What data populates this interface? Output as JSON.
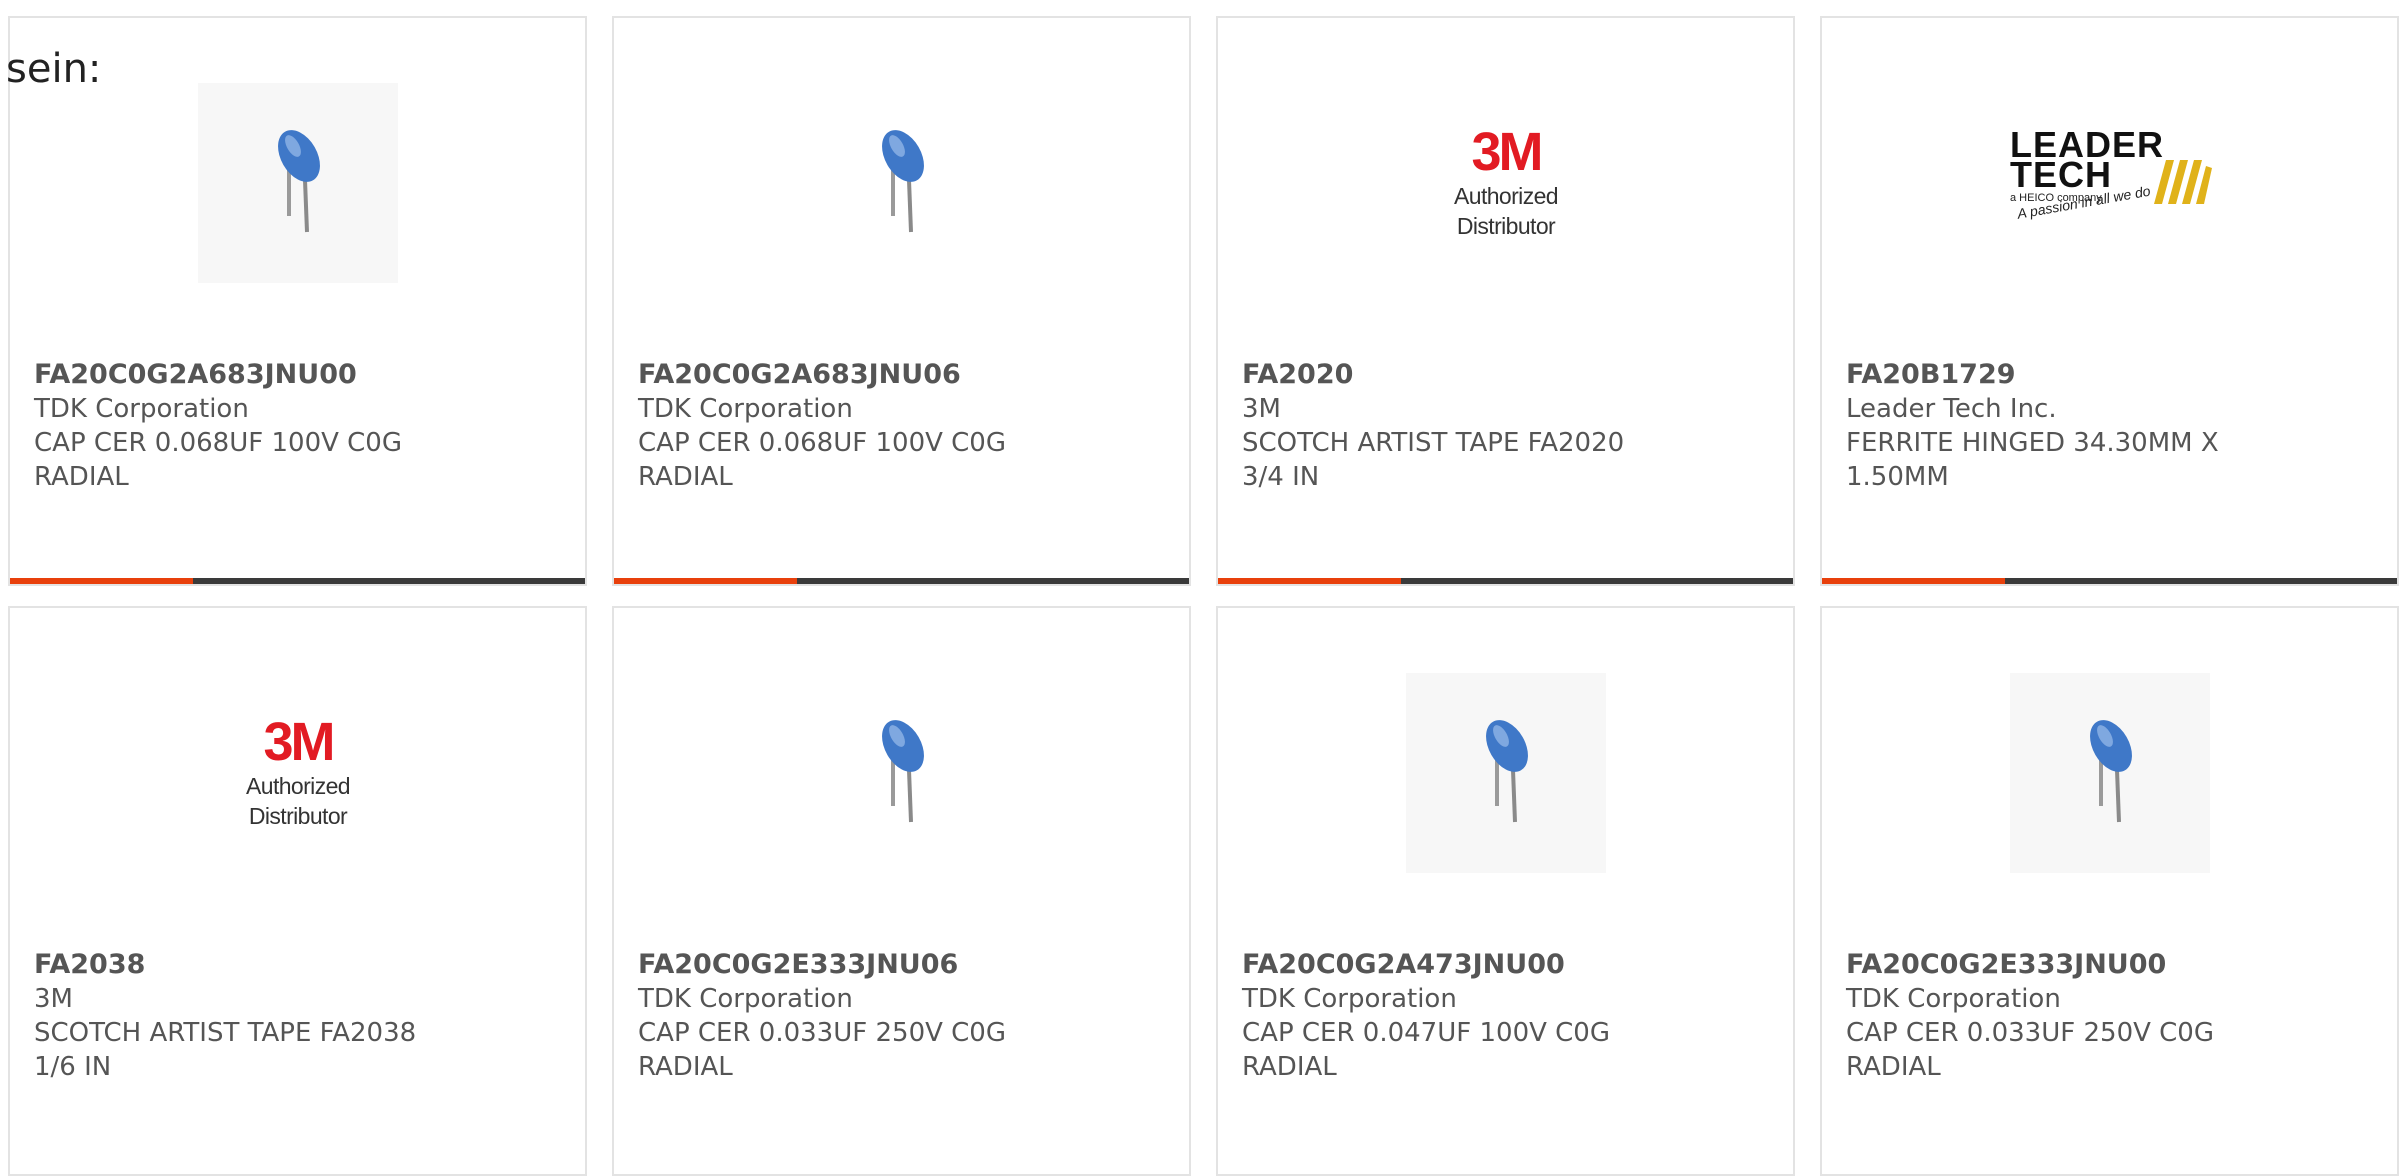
{
  "intro_text": "sein:",
  "colors": {
    "accent": "#e8400c",
    "bar": "#3a3a3a",
    "text": "#555555",
    "capacitor_blue": "#3f78c8"
  },
  "products": [
    {
      "part_number": "FA20C0G2A683JNU00",
      "manufacturer": "TDK Corporation",
      "description": "CAP CER 0.068UF 100V C0G RADIAL",
      "image": "capacitor-icon",
      "desc_lines": [
        "CAP CER 0.068UF 100V C0G",
        "RADIAL"
      ]
    },
    {
      "part_number": "FA20C0G2A683JNU06",
      "manufacturer": "TDK Corporation",
      "description": "CAP CER 0.068UF 100V C0G RADIAL",
      "image": "capacitor-icon",
      "desc_lines": [
        "CAP CER 0.068UF 100V C0G",
        "RADIAL"
      ]
    },
    {
      "part_number": "FA2020",
      "manufacturer": "3M",
      "description": "SCOTCH ARTIST TAPE FA2020 3/4 IN",
      "image": "3m-authorized-distributor-logo",
      "logo_mark": "3M",
      "logo_tagline": "Authorized Distributor",
      "desc_lines": [
        "SCOTCH ARTIST TAPE FA2020",
        "3/4 IN"
      ]
    },
    {
      "part_number": "FA20B1729",
      "manufacturer": "Leader Tech Inc.",
      "description": "FERRITE HINGED 34.30MM X 1.50MM",
      "image": "leader-tech-logo",
      "logo_line1": "LEADER",
      "logo_line2": "TECH",
      "logo_sub": "a HEICO company",
      "logo_slogan": "A passion in all we do",
      "desc_lines": [
        "FERRITE HINGED 34.30MM X",
        "1.50MM"
      ]
    },
    {
      "part_number": "FA2038",
      "manufacturer": "3M",
      "description": "SCOTCH ARTIST TAPE FA2038 1/6 IN",
      "image": "3m-authorized-distributor-logo",
      "logo_mark": "3M",
      "logo_tagline": "Authorized Distributor",
      "desc_lines": [
        "SCOTCH ARTIST TAPE FA2038",
        "1/6 IN"
      ]
    },
    {
      "part_number": "FA20C0G2E333JNU06",
      "manufacturer": "TDK Corporation",
      "description": "CAP CER 0.033UF 250V C0G RADIAL",
      "image": "capacitor-icon",
      "desc_lines": [
        "CAP CER 0.033UF 250V C0G",
        "RADIAL"
      ]
    },
    {
      "part_number": "FA20C0G2A473JNU00",
      "manufacturer": "TDK Corporation",
      "description": "CAP CER 0.047UF 100V C0G RADIAL",
      "image": "capacitor-icon",
      "desc_lines": [
        "CAP CER 0.047UF 100V C0G",
        "RADIAL"
      ]
    },
    {
      "part_number": "FA20C0G2E333JNU00",
      "manufacturer": "TDK Corporation",
      "description": "CAP CER 0.033UF 250V C0G RADIAL",
      "image": "capacitor-icon",
      "desc_lines": [
        "CAP CER 0.033UF 250V C0G",
        "RADIAL"
      ]
    }
  ]
}
